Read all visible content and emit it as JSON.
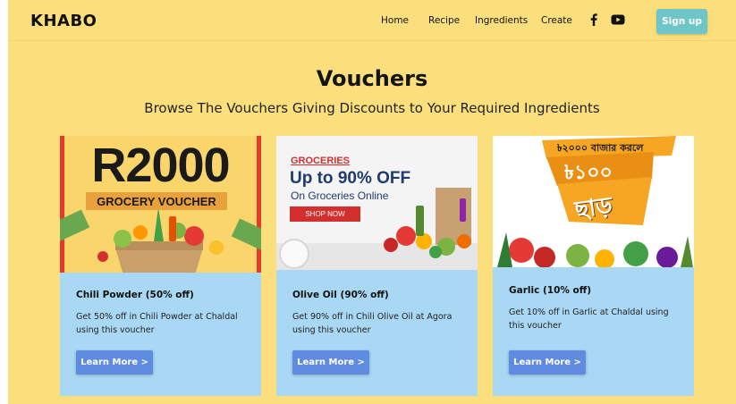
{
  "brand": "KHABO",
  "nav": {
    "home": "Home",
    "recipe": "Recipe",
    "ingredients": "Ingredients",
    "create": "Create",
    "signup": "Sign up",
    "social_icons": [
      "facebook-icon",
      "youtube-icon"
    ]
  },
  "hero": {
    "title": "Vouchers",
    "subtitle": "Browse The Vouchers Giving Discounts to Your Required Ingredients"
  },
  "colors": {
    "page_bg": "#fbdf7c",
    "card_bg": "#a8d8f4",
    "button": "#5f8be0",
    "signup_button": "#6fc6c9"
  },
  "cards": [
    {
      "title": "Chili Powder (50% off)",
      "desc": "Get 50% off in Chili Powder at Chaldal using this voucher",
      "button": "Learn More >",
      "image": {
        "headline": "R2000",
        "ribbon": "GROCERY VOUCHER"
      }
    },
    {
      "title": "Olive Oil (90% off)",
      "desc": "Get 90% off in Chili Olive Oil at Agora using this voucher",
      "button": "Learn More >",
      "image": {
        "tag": "GROCERIES",
        "headline": "Up to 90% OFF",
        "sub": "On Groceries Online",
        "cta": "SHOP NOW"
      }
    },
    {
      "title": "Garlic (10% off)",
      "desc": "Get 10% off in Garlic at Chaldal using this voucher",
      "button": "Learn More >",
      "image": {
        "top_line": "৳২০০০ বাজার করলে",
        "amount": "৳১০০",
        "word": "ছাড়"
      }
    }
  ]
}
